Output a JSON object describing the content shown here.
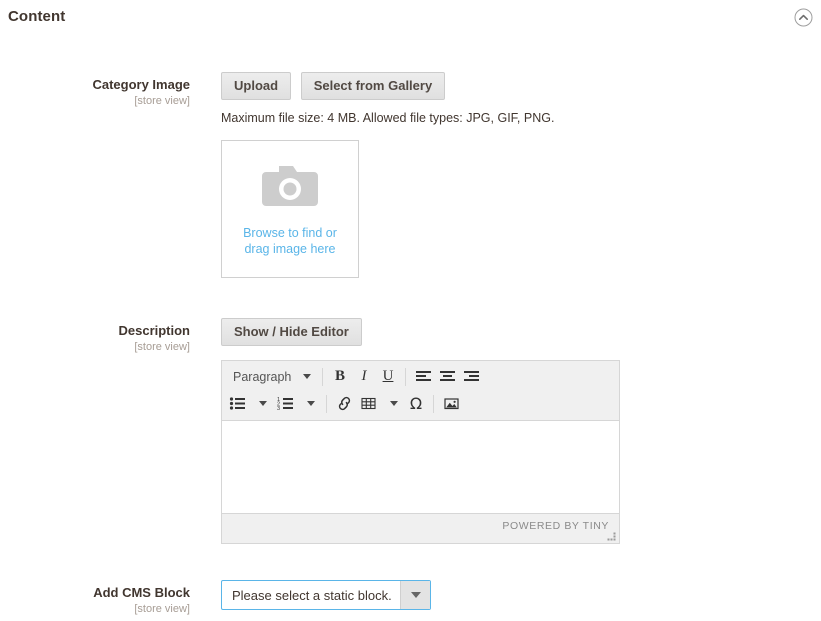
{
  "section": {
    "title": "Content",
    "collapse_icon": "chevron-up-circle-icon"
  },
  "fields": {
    "category_image": {
      "label": "Category Image",
      "scope": "[store view]",
      "upload_label": "Upload",
      "gallery_label": "Select from Gallery",
      "note": "Maximum file size: 4 MB. Allowed file types: JPG, GIF, PNG.",
      "dropzone": {
        "icon": "camera-icon",
        "line1": "Browse to find or",
        "line2": "drag image here",
        "link_color": "#5ab5e8"
      }
    },
    "description": {
      "label": "Description",
      "scope": "[store view]",
      "toggle_label": "Show / Hide Editor",
      "editor": {
        "format_select": "Paragraph",
        "content": "",
        "status_text": "POWERED BY TINY",
        "toolbar_row1": [
          {
            "name": "bold-icon",
            "glyph": "B"
          },
          {
            "name": "italic-icon",
            "glyph": "I"
          },
          {
            "name": "underline-icon",
            "glyph": "U"
          },
          {
            "name": "align-left-icon",
            "glyph": ""
          },
          {
            "name": "align-center-icon",
            "glyph": ""
          },
          {
            "name": "align-right-icon",
            "glyph": ""
          }
        ],
        "toolbar_row2": [
          {
            "name": "bullet-list-icon",
            "glyph": ""
          },
          {
            "name": "numbered-list-icon",
            "glyph": ""
          },
          {
            "name": "link-icon",
            "glyph": ""
          },
          {
            "name": "table-icon",
            "glyph": ""
          },
          {
            "name": "special-character-icon",
            "glyph": "Ω"
          },
          {
            "name": "insert-image-icon",
            "glyph": ""
          }
        ]
      }
    },
    "add_cms_block": {
      "label": "Add CMS Block",
      "scope": "[store view]",
      "selected_option": "Please select a static block.",
      "focus_color": "#5ab5e8"
    }
  }
}
